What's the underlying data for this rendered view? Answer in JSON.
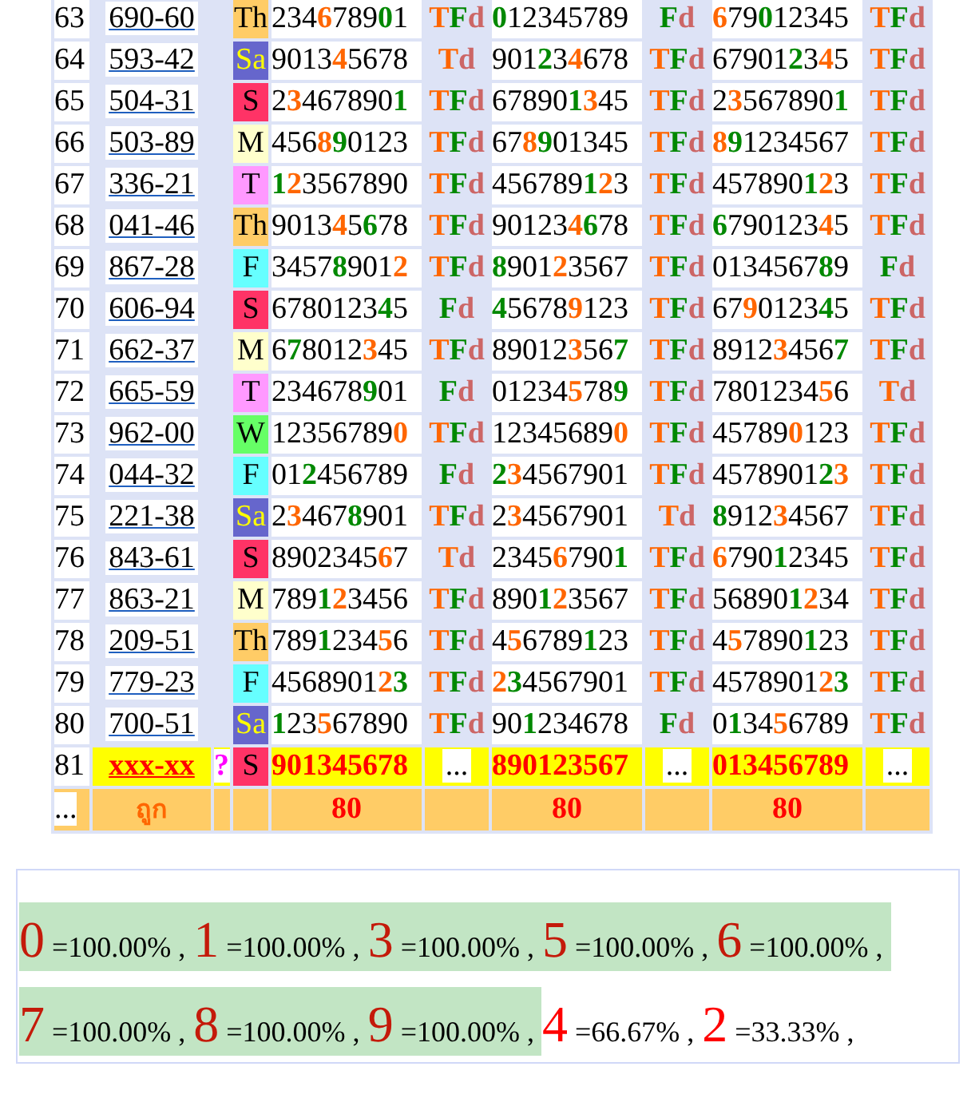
{
  "rows": [
    {
      "kind": "data",
      "no": "63",
      "code": "690-60",
      "day": {
        "text": "Th",
        "color": "#ffcc66",
        "inverse": false
      },
      "cells": [
        {
          "digits": [
            {
              "t": "234"
            },
            {
              "t": "6",
              "color": "#ff6600"
            },
            {
              "t": "789"
            },
            {
              "t": "0",
              "color": "#008800"
            },
            {
              "t": "1"
            }
          ],
          "tag": [
            {
              "t": "T",
              "color": "#ff6600"
            },
            {
              "t": "F",
              "color": "#008800"
            },
            {
              "t": "d",
              "color": "#cc6666"
            }
          ]
        },
        {
          "digits": [
            {
              "t": "0",
              "color": "#008800"
            },
            {
              "t": "12345789"
            }
          ],
          "tag": [
            {
              "t": "F",
              "color": "#008800"
            },
            {
              "t": "d",
              "color": "#cc6666"
            }
          ]
        },
        {
          "digits": [
            {
              "t": "6",
              "color": "#ff6600"
            },
            {
              "t": "79"
            },
            {
              "t": "0",
              "color": "#008800"
            },
            {
              "t": "12345"
            }
          ],
          "tag": [
            {
              "t": "T",
              "color": "#ff6600"
            },
            {
              "t": "F",
              "color": "#008800"
            },
            {
              "t": "d",
              "color": "#cc6666"
            }
          ]
        }
      ]
    },
    {
      "kind": "data",
      "no": "64",
      "code": "593-42",
      "day": {
        "text": "Sa",
        "color": "#6666cc",
        "inverse": true
      },
      "cells": [
        {
          "digits": [
            {
              "t": "9013"
            },
            {
              "t": "4",
              "color": "#ff6600"
            },
            {
              "t": "5678"
            }
          ],
          "tag": [
            {
              "t": "T",
              "color": "#ff6600"
            },
            {
              "t": "d",
              "color": "#cc6666"
            }
          ]
        },
        {
          "digits": [
            {
              "t": "901"
            },
            {
              "t": "2",
              "color": "#008800"
            },
            {
              "t": "3"
            },
            {
              "t": "4",
              "color": "#ff6600"
            },
            {
              "t": "678"
            }
          ],
          "tag": [
            {
              "t": "T",
              "color": "#ff6600"
            },
            {
              "t": "F",
              "color": "#008800"
            },
            {
              "t": "d",
              "color": "#cc6666"
            }
          ]
        },
        {
          "digits": [
            {
              "t": "67901"
            },
            {
              "t": "2",
              "color": "#008800"
            },
            {
              "t": "3"
            },
            {
              "t": "4",
              "color": "#ff6600"
            },
            {
              "t": "5"
            }
          ],
          "tag": [
            {
              "t": "T",
              "color": "#ff6600"
            },
            {
              "t": "F",
              "color": "#008800"
            },
            {
              "t": "d",
              "color": "#cc6666"
            }
          ]
        }
      ]
    },
    {
      "kind": "data",
      "no": "65",
      "code": "504-31",
      "day": {
        "text": "S",
        "color": "#ff3366",
        "inverse": false
      },
      "cells": [
        {
          "digits": [
            {
              "t": "2"
            },
            {
              "t": "3",
              "color": "#ff6600"
            },
            {
              "t": "467890"
            },
            {
              "t": "1",
              "color": "#008800"
            }
          ],
          "tag": [
            {
              "t": "T",
              "color": "#ff6600"
            },
            {
              "t": "F",
              "color": "#008800"
            },
            {
              "t": "d",
              "color": "#cc6666"
            }
          ]
        },
        {
          "digits": [
            {
              "t": "67890"
            },
            {
              "t": "1",
              "color": "#008800"
            },
            {
              "t": "3",
              "color": "#ff6600"
            },
            {
              "t": "45"
            }
          ],
          "tag": [
            {
              "t": "T",
              "color": "#ff6600"
            },
            {
              "t": "F",
              "color": "#008800"
            },
            {
              "t": "d",
              "color": "#cc6666"
            }
          ]
        },
        {
          "digits": [
            {
              "t": "2"
            },
            {
              "t": "3",
              "color": "#ff6600"
            },
            {
              "t": "567890"
            },
            {
              "t": "1",
              "color": "#008800"
            }
          ],
          "tag": [
            {
              "t": "T",
              "color": "#ff6600"
            },
            {
              "t": "F",
              "color": "#008800"
            },
            {
              "t": "d",
              "color": "#cc6666"
            }
          ]
        }
      ]
    },
    {
      "kind": "data",
      "no": "66",
      "code": "503-89",
      "day": {
        "text": "M",
        "color": "#ffffcc",
        "inverse": false
      },
      "cells": [
        {
          "digits": [
            {
              "t": "456"
            },
            {
              "t": "8",
              "color": "#ff6600"
            },
            {
              "t": "9",
              "color": "#008800"
            },
            {
              "t": "0123"
            }
          ],
          "tag": [
            {
              "t": "T",
              "color": "#ff6600"
            },
            {
              "t": "F",
              "color": "#008800"
            },
            {
              "t": "d",
              "color": "#cc6666"
            }
          ]
        },
        {
          "digits": [
            {
              "t": "67"
            },
            {
              "t": "8",
              "color": "#ff6600"
            },
            {
              "t": "9",
              "color": "#008800"
            },
            {
              "t": "01345"
            }
          ],
          "tag": [
            {
              "t": "T",
              "color": "#ff6600"
            },
            {
              "t": "F",
              "color": "#008800"
            },
            {
              "t": "d",
              "color": "#cc6666"
            }
          ]
        },
        {
          "digits": [
            {
              "t": "8",
              "color": "#ff6600"
            },
            {
              "t": "9",
              "color": "#008800"
            },
            {
              "t": "1234567"
            }
          ],
          "tag": [
            {
              "t": "T",
              "color": "#ff6600"
            },
            {
              "t": "F",
              "color": "#008800"
            },
            {
              "t": "d",
              "color": "#cc6666"
            }
          ]
        }
      ]
    },
    {
      "kind": "data",
      "no": "67",
      "code": "336-21",
      "day": {
        "text": "T",
        "color": "#ff99ff",
        "inverse": false
      },
      "cells": [
        {
          "digits": [
            {
              "t": "1",
              "color": "#008800"
            },
            {
              "t": "2",
              "color": "#ff6600"
            },
            {
              "t": "3567890"
            }
          ],
          "tag": [
            {
              "t": "T",
              "color": "#ff6600"
            },
            {
              "t": "F",
              "color": "#008800"
            },
            {
              "t": "d",
              "color": "#cc6666"
            }
          ]
        },
        {
          "digits": [
            {
              "t": "456789"
            },
            {
              "t": "1",
              "color": "#008800"
            },
            {
              "t": "2",
              "color": "#ff6600"
            },
            {
              "t": "3"
            }
          ],
          "tag": [
            {
              "t": "T",
              "color": "#ff6600"
            },
            {
              "t": "F",
              "color": "#008800"
            },
            {
              "t": "d",
              "color": "#cc6666"
            }
          ]
        },
        {
          "digits": [
            {
              "t": "457890"
            },
            {
              "t": "1",
              "color": "#008800"
            },
            {
              "t": "2",
              "color": "#ff6600"
            },
            {
              "t": "3"
            }
          ],
          "tag": [
            {
              "t": "T",
              "color": "#ff6600"
            },
            {
              "t": "F",
              "color": "#008800"
            },
            {
              "t": "d",
              "color": "#cc6666"
            }
          ]
        }
      ]
    },
    {
      "kind": "data",
      "no": "68",
      "code": "041-46",
      "day": {
        "text": "Th",
        "color": "#ffcc66",
        "inverse": false
      },
      "cells": [
        {
          "digits": [
            {
              "t": "9013"
            },
            {
              "t": "4",
              "color": "#ff6600"
            },
            {
              "t": "5"
            },
            {
              "t": "6",
              "color": "#008800"
            },
            {
              "t": "78"
            }
          ],
          "tag": [
            {
              "t": "T",
              "color": "#ff6600"
            },
            {
              "t": "F",
              "color": "#008800"
            },
            {
              "t": "d",
              "color": "#cc6666"
            }
          ]
        },
        {
          "digits": [
            {
              "t": "90123"
            },
            {
              "t": "4",
              "color": "#ff6600"
            },
            {
              "t": "6",
              "color": "#008800"
            },
            {
              "t": "78"
            }
          ],
          "tag": [
            {
              "t": "T",
              "color": "#ff6600"
            },
            {
              "t": "F",
              "color": "#008800"
            },
            {
              "t": "d",
              "color": "#cc6666"
            }
          ]
        },
        {
          "digits": [
            {
              "t": "6",
              "color": "#008800"
            },
            {
              "t": "790123"
            },
            {
              "t": "4",
              "color": "#ff6600"
            },
            {
              "t": "5"
            }
          ],
          "tag": [
            {
              "t": "T",
              "color": "#ff6600"
            },
            {
              "t": "F",
              "color": "#008800"
            },
            {
              "t": "d",
              "color": "#cc6666"
            }
          ]
        }
      ]
    },
    {
      "kind": "data",
      "no": "69",
      "code": "867-28",
      "day": {
        "text": "F",
        "color": "#66ffff",
        "inverse": false
      },
      "cells": [
        {
          "digits": [
            {
              "t": "3457"
            },
            {
              "t": "8",
              "color": "#008800"
            },
            {
              "t": "901"
            },
            {
              "t": "2",
              "color": "#ff6600"
            }
          ],
          "tag": [
            {
              "t": "T",
              "color": "#ff6600"
            },
            {
              "t": "F",
              "color": "#008800"
            },
            {
              "t": "d",
              "color": "#cc6666"
            }
          ]
        },
        {
          "digits": [
            {
              "t": "8",
              "color": "#008800"
            },
            {
              "t": "901"
            },
            {
              "t": "2",
              "color": "#ff6600"
            },
            {
              "t": "3567"
            }
          ],
          "tag": [
            {
              "t": "T",
              "color": "#ff6600"
            },
            {
              "t": "F",
              "color": "#008800"
            },
            {
              "t": "d",
              "color": "#cc6666"
            }
          ]
        },
        {
          "digits": [
            {
              "t": "0134567"
            },
            {
              "t": "8",
              "color": "#008800"
            },
            {
              "t": "9"
            }
          ],
          "tag": [
            {
              "t": "F",
              "color": "#008800"
            },
            {
              "t": "d",
              "color": "#cc6666"
            }
          ]
        }
      ]
    },
    {
      "kind": "data",
      "no": "70",
      "code": "606-94",
      "day": {
        "text": "S",
        "color": "#ff3366",
        "inverse": false
      },
      "cells": [
        {
          "digits": [
            {
              "t": "6780123"
            },
            {
              "t": "4",
              "color": "#008800"
            },
            {
              "t": "5"
            }
          ],
          "tag": [
            {
              "t": "F",
              "color": "#008800"
            },
            {
              "t": "d",
              "color": "#cc6666"
            }
          ]
        },
        {
          "digits": [
            {
              "t": "4",
              "color": "#008800"
            },
            {
              "t": "5678"
            },
            {
              "t": "9",
              "color": "#ff6600"
            },
            {
              "t": "123"
            }
          ],
          "tag": [
            {
              "t": "T",
              "color": "#ff6600"
            },
            {
              "t": "F",
              "color": "#008800"
            },
            {
              "t": "d",
              "color": "#cc6666"
            }
          ]
        },
        {
          "digits": [
            {
              "t": "67"
            },
            {
              "t": "9",
              "color": "#ff6600"
            },
            {
              "t": "0123"
            },
            {
              "t": "4",
              "color": "#008800"
            },
            {
              "t": "5"
            }
          ],
          "tag": [
            {
              "t": "T",
              "color": "#ff6600"
            },
            {
              "t": "F",
              "color": "#008800"
            },
            {
              "t": "d",
              "color": "#cc6666"
            }
          ]
        }
      ]
    },
    {
      "kind": "data",
      "no": "71",
      "code": "662-37",
      "day": {
        "text": "M",
        "color": "#ffffcc",
        "inverse": false
      },
      "cells": [
        {
          "digits": [
            {
              "t": "6"
            },
            {
              "t": "7",
              "color": "#008800"
            },
            {
              "t": "8012"
            },
            {
              "t": "3",
              "color": "#ff6600"
            },
            {
              "t": "45"
            }
          ],
          "tag": [
            {
              "t": "T",
              "color": "#ff6600"
            },
            {
              "t": "F",
              "color": "#008800"
            },
            {
              "t": "d",
              "color": "#cc6666"
            }
          ]
        },
        {
          "digits": [
            {
              "t": "89012"
            },
            {
              "t": "3",
              "color": "#ff6600"
            },
            {
              "t": "56"
            },
            {
              "t": "7",
              "color": "#008800"
            }
          ],
          "tag": [
            {
              "t": "T",
              "color": "#ff6600"
            },
            {
              "t": "F",
              "color": "#008800"
            },
            {
              "t": "d",
              "color": "#cc6666"
            }
          ]
        },
        {
          "digits": [
            {
              "t": "8912"
            },
            {
              "t": "3",
              "color": "#ff6600"
            },
            {
              "t": "456"
            },
            {
              "t": "7",
              "color": "#008800"
            }
          ],
          "tag": [
            {
              "t": "T",
              "color": "#ff6600"
            },
            {
              "t": "F",
              "color": "#008800"
            },
            {
              "t": "d",
              "color": "#cc6666"
            }
          ]
        }
      ]
    },
    {
      "kind": "data",
      "no": "72",
      "code": "665-59",
      "day": {
        "text": "T",
        "color": "#ff99ff",
        "inverse": false
      },
      "cells": [
        {
          "digits": [
            {
              "t": "234678"
            },
            {
              "t": "9",
              "color": "#008800"
            },
            {
              "t": "01"
            }
          ],
          "tag": [
            {
              "t": "F",
              "color": "#008800"
            },
            {
              "t": "d",
              "color": "#cc6666"
            }
          ]
        },
        {
          "digits": [
            {
              "t": "01234"
            },
            {
              "t": "5",
              "color": "#ff6600"
            },
            {
              "t": "78"
            },
            {
              "t": "9",
              "color": "#008800"
            }
          ],
          "tag": [
            {
              "t": "T",
              "color": "#ff6600"
            },
            {
              "t": "F",
              "color": "#008800"
            },
            {
              "t": "d",
              "color": "#cc6666"
            }
          ]
        },
        {
          "digits": [
            {
              "t": "7801234"
            },
            {
              "t": "5",
              "color": "#ff6600"
            },
            {
              "t": "6"
            }
          ],
          "tag": [
            {
              "t": "T",
              "color": "#ff6600"
            },
            {
              "t": "d",
              "color": "#cc6666"
            }
          ]
        }
      ]
    },
    {
      "kind": "data",
      "no": "73",
      "code": "962-00",
      "day": {
        "text": "W",
        "color": "#66ff66",
        "inverse": false
      },
      "cells": [
        {
          "digits": [
            {
              "t": "12356789"
            },
            {
              "t": "0",
              "color": "#ff6600"
            }
          ],
          "tag": [
            {
              "t": "T",
              "color": "#ff6600"
            },
            {
              "t": "F",
              "color": "#008800"
            },
            {
              "t": "d",
              "color": "#cc6666"
            }
          ]
        },
        {
          "digits": [
            {
              "t": "12345689"
            },
            {
              "t": "0",
              "color": "#ff6600"
            }
          ],
          "tag": [
            {
              "t": "T",
              "color": "#ff6600"
            },
            {
              "t": "F",
              "color": "#008800"
            },
            {
              "t": "d",
              "color": "#cc6666"
            }
          ]
        },
        {
          "digits": [
            {
              "t": "45789"
            },
            {
              "t": "0",
              "color": "#ff6600"
            },
            {
              "t": "123"
            }
          ],
          "tag": [
            {
              "t": "T",
              "color": "#ff6600"
            },
            {
              "t": "F",
              "color": "#008800"
            },
            {
              "t": "d",
              "color": "#cc6666"
            }
          ]
        }
      ]
    },
    {
      "kind": "data",
      "no": "74",
      "code": "044-32",
      "day": {
        "text": "F",
        "color": "#66ffff",
        "inverse": false
      },
      "cells": [
        {
          "digits": [
            {
              "t": "01"
            },
            {
              "t": "2",
              "color": "#008800"
            },
            {
              "t": "456789"
            }
          ],
          "tag": [
            {
              "t": "F",
              "color": "#008800"
            },
            {
              "t": "d",
              "color": "#cc6666"
            }
          ]
        },
        {
          "digits": [
            {
              "t": "2",
              "color": "#008800"
            },
            {
              "t": "3",
              "color": "#ff6600"
            },
            {
              "t": "4567901"
            }
          ],
          "tag": [
            {
              "t": "T",
              "color": "#ff6600"
            },
            {
              "t": "F",
              "color": "#008800"
            },
            {
              "t": "d",
              "color": "#cc6666"
            }
          ]
        },
        {
          "digits": [
            {
              "t": "4578901"
            },
            {
              "t": "2",
              "color": "#008800"
            },
            {
              "t": "3",
              "color": "#ff6600"
            }
          ],
          "tag": [
            {
              "t": "T",
              "color": "#ff6600"
            },
            {
              "t": "F",
              "color": "#008800"
            },
            {
              "t": "d",
              "color": "#cc6666"
            }
          ]
        }
      ]
    },
    {
      "kind": "data",
      "no": "75",
      "code": "221-38",
      "day": {
        "text": "Sa",
        "color": "#6666cc",
        "inverse": true
      },
      "cells": [
        {
          "digits": [
            {
              "t": "2"
            },
            {
              "t": "3",
              "color": "#ff6600"
            },
            {
              "t": "467"
            },
            {
              "t": "8",
              "color": "#008800"
            },
            {
              "t": "901"
            }
          ],
          "tag": [
            {
              "t": "T",
              "color": "#ff6600"
            },
            {
              "t": "F",
              "color": "#008800"
            },
            {
              "t": "d",
              "color": "#cc6666"
            }
          ]
        },
        {
          "digits": [
            {
              "t": "2"
            },
            {
              "t": "3",
              "color": "#ff6600"
            },
            {
              "t": "4567901"
            }
          ],
          "tag": [
            {
              "t": "T",
              "color": "#ff6600"
            },
            {
              "t": "d",
              "color": "#cc6666"
            }
          ]
        },
        {
          "digits": [
            {
              "t": "8",
              "color": "#008800"
            },
            {
              "t": "912"
            },
            {
              "t": "3",
              "color": "#ff6600"
            },
            {
              "t": "4567"
            }
          ],
          "tag": [
            {
              "t": "T",
              "color": "#ff6600"
            },
            {
              "t": "F",
              "color": "#008800"
            },
            {
              "t": "d",
              "color": "#cc6666"
            }
          ]
        }
      ]
    },
    {
      "kind": "data",
      "no": "76",
      "code": "843-61",
      "day": {
        "text": "S",
        "color": "#ff3366",
        "inverse": false
      },
      "cells": [
        {
          "digits": [
            {
              "t": "8902345"
            },
            {
              "t": "6",
              "color": "#ff6600"
            },
            {
              "t": "7"
            }
          ],
          "tag": [
            {
              "t": "T",
              "color": "#ff6600"
            },
            {
              "t": "d",
              "color": "#cc6666"
            }
          ]
        },
        {
          "digits": [
            {
              "t": "2345"
            },
            {
              "t": "6",
              "color": "#ff6600"
            },
            {
              "t": "790"
            },
            {
              "t": "1",
              "color": "#008800"
            }
          ],
          "tag": [
            {
              "t": "T",
              "color": "#ff6600"
            },
            {
              "t": "F",
              "color": "#008800"
            },
            {
              "t": "d",
              "color": "#cc6666"
            }
          ]
        },
        {
          "digits": [
            {
              "t": "6",
              "color": "#ff6600"
            },
            {
              "t": "790"
            },
            {
              "t": "1",
              "color": "#008800"
            },
            {
              "t": "2345"
            }
          ],
          "tag": [
            {
              "t": "T",
              "color": "#ff6600"
            },
            {
              "t": "F",
              "color": "#008800"
            },
            {
              "t": "d",
              "color": "#cc6666"
            }
          ]
        }
      ]
    },
    {
      "kind": "data",
      "no": "77",
      "code": "863-21",
      "day": {
        "text": "M",
        "color": "#ffffcc",
        "inverse": false
      },
      "cells": [
        {
          "digits": [
            {
              "t": "789"
            },
            {
              "t": "1",
              "color": "#008800"
            },
            {
              "t": "2",
              "color": "#ff6600"
            },
            {
              "t": "3456"
            }
          ],
          "tag": [
            {
              "t": "T",
              "color": "#ff6600"
            },
            {
              "t": "F",
              "color": "#008800"
            },
            {
              "t": "d",
              "color": "#cc6666"
            }
          ]
        },
        {
          "digits": [
            {
              "t": "890"
            },
            {
              "t": "1",
              "color": "#008800"
            },
            {
              "t": "2",
              "color": "#ff6600"
            },
            {
              "t": "3567"
            }
          ],
          "tag": [
            {
              "t": "T",
              "color": "#ff6600"
            },
            {
              "t": "F",
              "color": "#008800"
            },
            {
              "t": "d",
              "color": "#cc6666"
            }
          ]
        },
        {
          "digits": [
            {
              "t": "56890"
            },
            {
              "t": "1",
              "color": "#008800"
            },
            {
              "t": "2",
              "color": "#ff6600"
            },
            {
              "t": "34"
            }
          ],
          "tag": [
            {
              "t": "T",
              "color": "#ff6600"
            },
            {
              "t": "F",
              "color": "#008800"
            },
            {
              "t": "d",
              "color": "#cc6666"
            }
          ]
        }
      ]
    },
    {
      "kind": "data",
      "no": "78",
      "code": "209-51",
      "day": {
        "text": "Th",
        "color": "#ffcc66",
        "inverse": false
      },
      "cells": [
        {
          "digits": [
            {
              "t": "789"
            },
            {
              "t": "1",
              "color": "#008800"
            },
            {
              "t": "234"
            },
            {
              "t": "5",
              "color": "#ff6600"
            },
            {
              "t": "6"
            }
          ],
          "tag": [
            {
              "t": "T",
              "color": "#ff6600"
            },
            {
              "t": "F",
              "color": "#008800"
            },
            {
              "t": "d",
              "color": "#cc6666"
            }
          ]
        },
        {
          "digits": [
            {
              "t": "4"
            },
            {
              "t": "5",
              "color": "#ff6600"
            },
            {
              "t": "6789"
            },
            {
              "t": "1",
              "color": "#008800"
            },
            {
              "t": "23"
            }
          ],
          "tag": [
            {
              "t": "T",
              "color": "#ff6600"
            },
            {
              "t": "F",
              "color": "#008800"
            },
            {
              "t": "d",
              "color": "#cc6666"
            }
          ]
        },
        {
          "digits": [
            {
              "t": "4"
            },
            {
              "t": "5",
              "color": "#ff6600"
            },
            {
              "t": "7890"
            },
            {
              "t": "1",
              "color": "#008800"
            },
            {
              "t": "23"
            }
          ],
          "tag": [
            {
              "t": "T",
              "color": "#ff6600"
            },
            {
              "t": "F",
              "color": "#008800"
            },
            {
              "t": "d",
              "color": "#cc6666"
            }
          ]
        }
      ]
    },
    {
      "kind": "data",
      "no": "79",
      "code": "779-23",
      "day": {
        "text": "F",
        "color": "#66ffff",
        "inverse": false
      },
      "cells": [
        {
          "digits": [
            {
              "t": "4568901"
            },
            {
              "t": "2",
              "color": "#ff6600"
            },
            {
              "t": "3",
              "color": "#008800"
            }
          ],
          "tag": [
            {
              "t": "T",
              "color": "#ff6600"
            },
            {
              "t": "F",
              "color": "#008800"
            },
            {
              "t": "d",
              "color": "#cc6666"
            }
          ]
        },
        {
          "digits": [
            {
              "t": "2",
              "color": "#ff6600"
            },
            {
              "t": "3",
              "color": "#008800"
            },
            {
              "t": "4567901"
            }
          ],
          "tag": [
            {
              "t": "T",
              "color": "#ff6600"
            },
            {
              "t": "F",
              "color": "#008800"
            },
            {
              "t": "d",
              "color": "#cc6666"
            }
          ]
        },
        {
          "digits": [
            {
              "t": "4578901"
            },
            {
              "t": "2",
              "color": "#ff6600"
            },
            {
              "t": "3",
              "color": "#008800"
            }
          ],
          "tag": [
            {
              "t": "T",
              "color": "#ff6600"
            },
            {
              "t": "F",
              "color": "#008800"
            },
            {
              "t": "d",
              "color": "#cc6666"
            }
          ]
        }
      ]
    },
    {
      "kind": "data",
      "no": "80",
      "code": "700-51",
      "day": {
        "text": "Sa",
        "color": "#6666cc",
        "inverse": true
      },
      "cells": [
        {
          "digits": [
            {
              "t": "1",
              "color": "#008800"
            },
            {
              "t": "23"
            },
            {
              "t": "5",
              "color": "#ff6600"
            },
            {
              "t": "67890"
            }
          ],
          "tag": [
            {
              "t": "T",
              "color": "#ff6600"
            },
            {
              "t": "F",
              "color": "#008800"
            },
            {
              "t": "d",
              "color": "#cc6666"
            }
          ]
        },
        {
          "digits": [
            {
              "t": "90"
            },
            {
              "t": "1",
              "color": "#008800"
            },
            {
              "t": "234678"
            }
          ],
          "tag": [
            {
              "t": "F",
              "color": "#008800"
            },
            {
              "t": "d",
              "color": "#cc6666"
            }
          ]
        },
        {
          "digits": [
            {
              "t": "0"
            },
            {
              "t": "1",
              "color": "#008800"
            },
            {
              "t": "34"
            },
            {
              "t": "5",
              "color": "#ff6600"
            },
            {
              "t": "6789"
            }
          ],
          "tag": [
            {
              "t": "T",
              "color": "#ff6600"
            },
            {
              "t": "F",
              "color": "#008800"
            },
            {
              "t": "d",
              "color": "#cc6666"
            }
          ]
        }
      ]
    },
    {
      "kind": "pending",
      "no": "81",
      "code": "xxx-xx",
      "flag": "?",
      "day": {
        "text": "S",
        "color": "#ff3366",
        "inverse": false
      },
      "cells": [
        {
          "digits": [
            {
              "t": "901345678",
              "color": "#ff0000"
            }
          ],
          "tag": [
            {
              "t": "..."
            }
          ]
        },
        {
          "digits": [
            {
              "t": "890123567",
              "color": "#ff0000"
            }
          ],
          "tag": [
            {
              "t": "..."
            }
          ]
        },
        {
          "digits": [
            {
              "t": "013456789",
              "color": "#ff0000"
            }
          ],
          "tag": [
            {
              "t": "..."
            }
          ]
        }
      ]
    }
  ],
  "footer": {
    "more": "...",
    "label": "ถูก",
    "counts": [
      "80",
      "80",
      "80"
    ]
  },
  "stats": [
    {
      "digit": "0",
      "value": "=100.00%",
      "sep": ",",
      "highlighted": true
    },
    {
      "digit": "1",
      "value": "=100.00%",
      "sep": ",",
      "highlighted": true
    },
    {
      "digit": "3",
      "value": "=100.00%",
      "sep": ",",
      "highlighted": true
    },
    {
      "digit": "5",
      "value": "=100.00%",
      "sep": ",",
      "highlighted": true
    },
    {
      "digit": "6",
      "value": "=100.00%",
      "sep": ",",
      "highlighted": true
    },
    {
      "digit": "7",
      "value": "=100.00%",
      "sep": ",",
      "highlighted": true
    },
    {
      "digit": "8",
      "value": "=100.00%",
      "sep": ",",
      "highlighted": true
    },
    {
      "digit": "9",
      "value": "=100.00%",
      "sep": ",",
      "highlighted": true
    },
    {
      "digit": "4",
      "value": "=66.67%",
      "sep": ",",
      "highlighted": false
    },
    {
      "digit": "2",
      "value": "=33.33%",
      "sep": ",",
      "highlighted": false
    }
  ]
}
